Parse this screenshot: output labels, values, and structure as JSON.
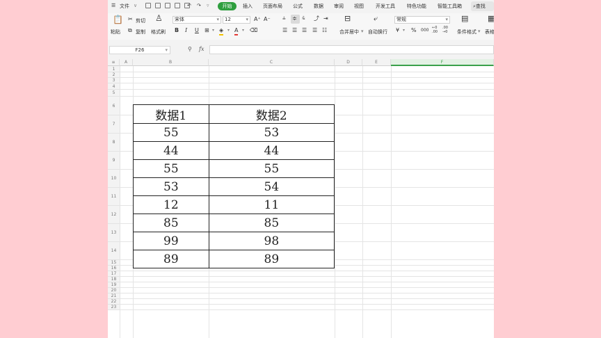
{
  "menu": {
    "file": "文件",
    "tabs": [
      "开始",
      "插入",
      "页面布局",
      "公式",
      "数据",
      "审阅",
      "视图",
      "开发工具",
      "特色功能",
      "智能工具箱"
    ],
    "search": "查找"
  },
  "ribbon": {
    "paste": "粘贴",
    "cut": "剪切",
    "copy": "复制",
    "format_painter": "格式刷",
    "font_name": "宋体",
    "font_size": "12",
    "merge_center": "合并居中",
    "auto_wrap": "自动换行",
    "number_format": "常规",
    "conditional_format": "条件格式",
    "table_style": "表格"
  },
  "formula_bar": {
    "cell_ref": "F26",
    "fx": "fx",
    "value": ""
  },
  "sheet": {
    "columns": [
      "A",
      "B",
      "C",
      "D",
      "E",
      "F"
    ],
    "selected_column": "F",
    "rows": [
      "1",
      "2",
      "3",
      "4",
      "5",
      "6",
      "7",
      "8",
      "9",
      "10",
      "11",
      "12",
      "13",
      "14",
      "15",
      "16",
      "17",
      "18",
      "19",
      "20",
      "21",
      "22",
      "23"
    ]
  },
  "table": {
    "headers": [
      "数据1",
      "数据2"
    ],
    "rows": [
      [
        "55",
        "53"
      ],
      [
        "44",
        "44"
      ],
      [
        "55",
        "55"
      ],
      [
        "53",
        "54"
      ],
      [
        "12",
        "11"
      ],
      [
        "85",
        "85"
      ],
      [
        "99",
        "98"
      ],
      [
        "89",
        "89"
      ]
    ]
  }
}
